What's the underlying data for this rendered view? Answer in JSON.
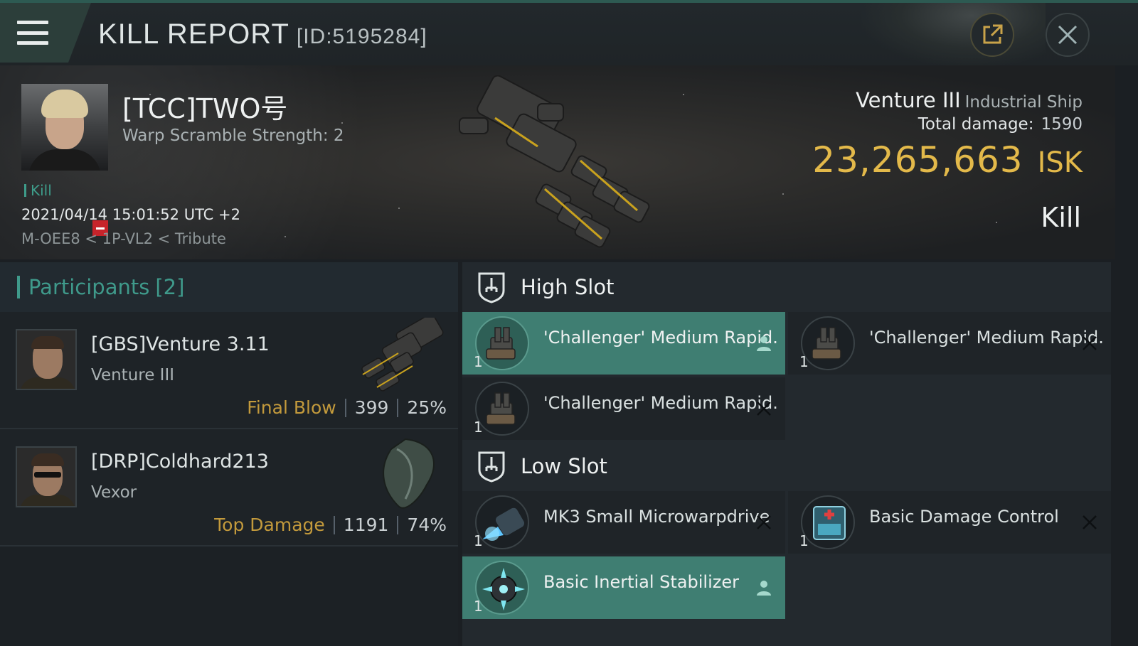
{
  "header": {
    "title": "KILL REPORT",
    "report_id": "[ID:5195284]",
    "menu_icon": "hamburger-menu-icon",
    "share_icon": "share-icon",
    "close_icon": "close-icon"
  },
  "victim": {
    "name": "[TCC]TWO号",
    "warp_scramble": "Warp Scramble Strength: 2",
    "tag": "Kill",
    "datetime": "2021/04/14 15:01:52 UTC +2",
    "location": "M-OEE8 < 1P-VL2 < Tribute"
  },
  "ship": {
    "name": "Venture III",
    "class": "Industrial Ship",
    "damage_label": "Total damage:",
    "damage_value": "1590",
    "isk_value": "23,265,663",
    "isk_unit": "ISK",
    "result": "Kill"
  },
  "participants": {
    "label": "Participants",
    "count": "[2]",
    "rows": [
      {
        "name": "[GBS]Venture 3.11",
        "ship": "Venture III",
        "role": "Final Blow",
        "damage": "399",
        "percent": "25%"
      },
      {
        "name": "[DRP]Coldhard213",
        "ship": "Vexor",
        "role": "Top Damage",
        "damage": "1191",
        "percent": "74%"
      }
    ]
  },
  "fitting": {
    "high_slot": {
      "label": "High Slot",
      "modules": [
        {
          "name": "'Challenger' Medium Rapid...",
          "qty": "1",
          "state": "dropped"
        },
        {
          "name": "'Challenger' Medium Rapid...",
          "qty": "1",
          "state": "destroyed"
        },
        {
          "name": "'Challenger' Medium Rapid...",
          "qty": "1",
          "state": "destroyed"
        }
      ]
    },
    "low_slot": {
      "label": "Low Slot",
      "modules": [
        {
          "name": "MK3 Small Microwarpdrive",
          "qty": "1",
          "state": "destroyed"
        },
        {
          "name": "Basic Damage Control",
          "qty": "1",
          "state": "destroyed"
        },
        {
          "name": "Basic Inertial Stabilizer",
          "qty": "1",
          "state": "dropped"
        }
      ]
    }
  },
  "colors": {
    "accent_teal": "#3f9a8b",
    "dropped_bg": "#3f7e72",
    "isk_gold": "#e3b94a",
    "role_gold": "#c39a3c",
    "destroyed_badge": "#c8242b"
  }
}
